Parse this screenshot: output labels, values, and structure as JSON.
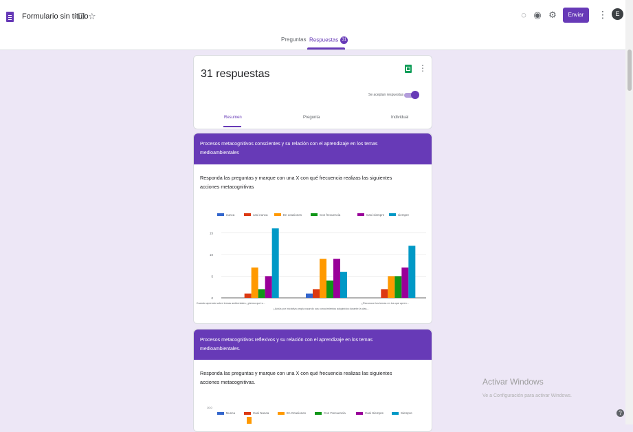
{
  "header": {
    "title": "Formulario sin título",
    "send_label": "Enviar",
    "avatar_letter": "E"
  },
  "tabs": [
    {
      "label": "Preguntas"
    },
    {
      "label": "Respuestas",
      "badge": "31"
    }
  ],
  "summary": {
    "count_label": "31 respuestas",
    "accept_label": "Se aceptan respuestas",
    "subtabs": [
      "Resumen",
      "Pregunta",
      "Individual"
    ]
  },
  "section1": {
    "title": "Procesos metacognitivos conscientes y su relación con el aprendizaje en los temas medioambientales",
    "question": "Responda las preguntas y marque con una X con qué frecuencia realizas las siguientes acciones metacognitivas"
  },
  "section2": {
    "title": "Procesos metacognitivos reflexivos y su relación con el aprendizaje en los temas medioambientales.",
    "question": "Responda las preguntas y marque con una X con qué frecuencia realizas las siguientes acciones metacognitivas.",
    "first_tick": "10.0"
  },
  "chart2_legend": [
    "Nunca",
    "Casi Nunca",
    "En Ocasiones",
    "Con Frecuencia",
    "Casi Siempre",
    "Siempre"
  ],
  "watermark": {
    "title": "Activar Windows",
    "subtitle": "Ve a Configuración para activar Windows."
  },
  "chart_data": [
    {
      "type": "bar",
      "categories": [
        "Cuando aprendo sobre temas ambientales ¿pienso qué s...",
        "¿Actúa por iniciativa propia usando sus conocimientos adquiridos durante la clas...",
        "¿Reconoce los temas en los que apren..."
      ],
      "series": [
        {
          "name": "nunca",
          "color": "#3366cc",
          "values": [
            0,
            1,
            0
          ]
        },
        {
          "name": "casi nunca",
          "color": "#dc3912",
          "values": [
            1,
            2,
            2
          ]
        },
        {
          "name": "En ocasiones",
          "color": "#ff9900",
          "values": [
            7,
            9,
            5
          ]
        },
        {
          "name": "Con frecuencia",
          "color": "#109618",
          "values": [
            2,
            4,
            5
          ]
        },
        {
          "name": "Casi siempre",
          "color": "#990099",
          "values": [
            5,
            9,
            7
          ]
        },
        {
          "name": "siempre",
          "color": "#0099c6",
          "values": [
            16,
            6,
            12
          ]
        }
      ],
      "yticks": [
        0,
        5,
        10,
        15
      ],
      "ylim": [
        0,
        16
      ],
      "grid": true,
      "legend": "top"
    }
  ]
}
